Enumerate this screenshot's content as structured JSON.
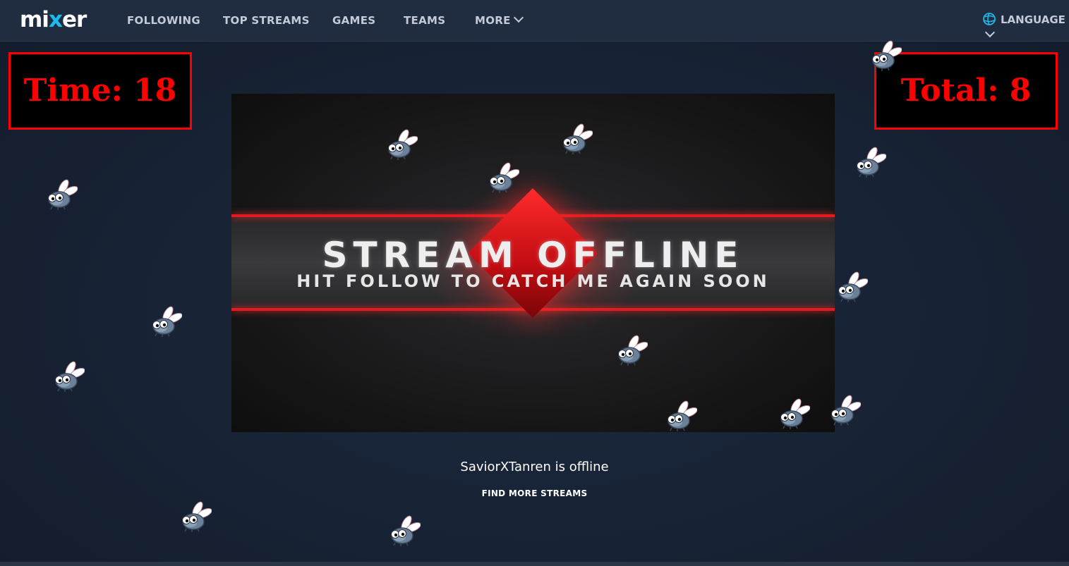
{
  "nav": {
    "logo_prefix": "mi",
    "logo_x": "x",
    "logo_suffix": "er",
    "items": [
      "FOLLOWING",
      "TOP STREAMS",
      "GAMES",
      "TEAMS",
      "MORE"
    ],
    "language": "LANGUAGE"
  },
  "game": {
    "time_label": "Time: 18",
    "total_label": "Total: 8",
    "time_value": 18,
    "total_value": 8,
    "fly_count": 16,
    "accent_color": "#ff0000"
  },
  "banner": {
    "title": "STREAM OFFLINE",
    "subtitle": "HIT FOLLOW TO CATCH ME AGAIN SOON"
  },
  "status": {
    "message": "SaviorXTanren is offline",
    "find_more": "FIND MORE STREAMS"
  },
  "colors": {
    "brand_blue": "#1fbaed",
    "nav_bg": "#202d40",
    "page_bg": "#172234",
    "banner_red": "#e01b22"
  }
}
